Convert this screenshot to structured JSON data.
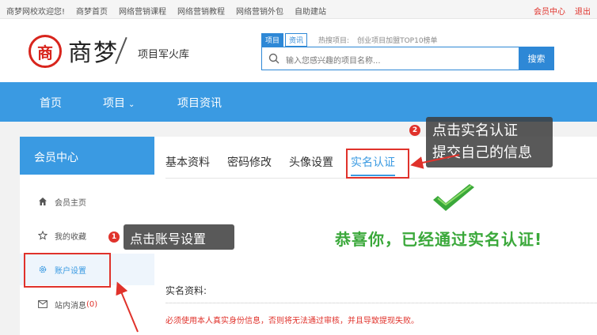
{
  "topbar": {
    "links": [
      "商梦网校欢迎您!",
      "商梦首页",
      "网络营销课程",
      "网络营销教程",
      "网络营销外包",
      "自助建站"
    ],
    "member": "会员中心",
    "logout": "退出"
  },
  "header": {
    "logo_seal": "商",
    "logo_text": "商梦",
    "logo_sub": "项目军火库",
    "search_tab_project": "项目",
    "search_tab_news": "资讯",
    "hot_label": "热搜项目:",
    "hot_item": "创业项目加盟TOP10榜单",
    "search_placeholder": "输入您感兴趣的项目名称...",
    "search_button": "搜索"
  },
  "nav": {
    "home": "首页",
    "projects": "项目",
    "news": "项目资讯"
  },
  "sidebar": {
    "title": "会员中心",
    "items": [
      {
        "label": "会员主页",
        "icon": "home-icon"
      },
      {
        "label": "我的收藏",
        "icon": "star-icon"
      },
      {
        "label": "账户设置",
        "icon": "gear-icon"
      },
      {
        "label": "站内消息",
        "icon": "mail-icon",
        "count": "(0)"
      }
    ]
  },
  "main": {
    "tabs": [
      "基本资料",
      "密码修改",
      "头像设置",
      "实名认证"
    ],
    "active_tab": 3,
    "congrats": "恭喜你，已经通过实名认证!",
    "info_label": "实名资料:",
    "warning": "必须使用本人真实身份信息，否则将无法通过审核，并且导致提现失败。"
  },
  "annotations": {
    "step1_num": "1",
    "step1_text": "点击账号设置",
    "step2_num": "2",
    "step2_line1": "点击实名认证",
    "step2_line2": "提交自己的信息"
  },
  "colors": {
    "primary": "#3a9ae2",
    "accent_red": "#e0322b",
    "success": "#3aa83a"
  }
}
